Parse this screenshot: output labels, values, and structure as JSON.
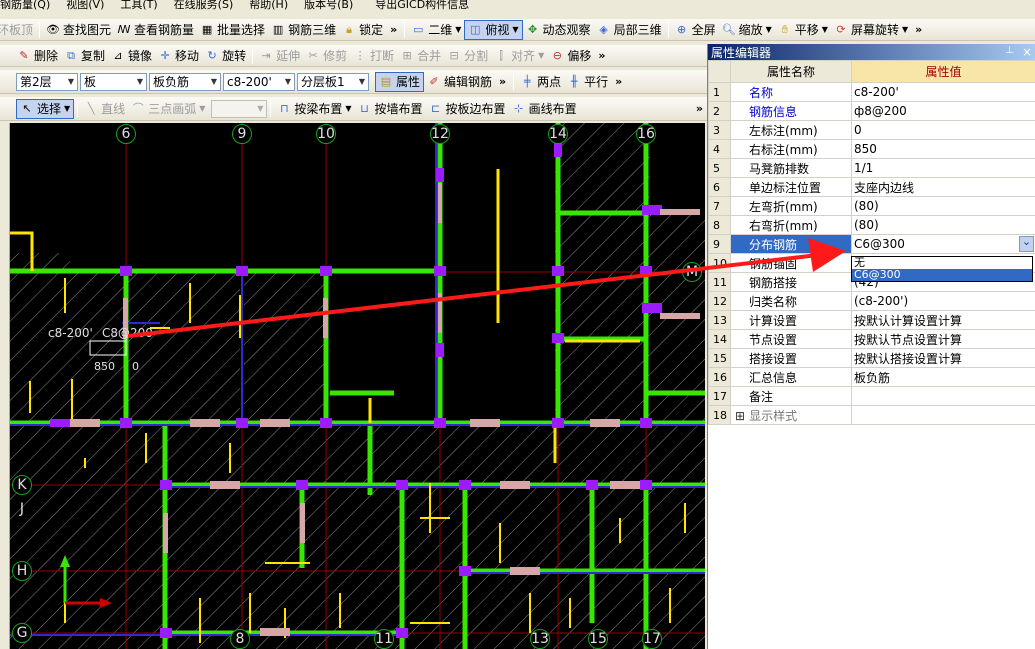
{
  "toolbar1": {
    "items": [
      "环板顶",
      "查找图元",
      "查看钢筋量",
      "批量选择",
      "钢筋三维",
      "锁定",
      "二维",
      "俯视",
      "动态观察",
      "局部三维",
      "全屏",
      "缩放",
      "平移",
      "屏幕旋转"
    ]
  },
  "menubar": {
    "items": [
      "钢筋量(Q)",
      "视图(V)",
      "工具(T)",
      "在线服务(S)",
      "帮助(H)",
      "版本号(B)",
      "导出GICD构件信息"
    ]
  },
  "toolbar2": {
    "items": [
      "删除",
      "复制",
      "镜像",
      "移动",
      "旋转",
      "延伸",
      "修剪",
      "打断",
      "合并",
      "分割",
      "对齐",
      "偏移"
    ]
  },
  "toolbar3": {
    "floor": "第2层",
    "type": "板",
    "subtype": "板负筋",
    "spec": "c8-200'",
    "layer": "分层板1",
    "prop_button": "属性",
    "edit_button": "编辑钢筋",
    "two_point": "两点",
    "parallel": "平行"
  },
  "toolbar4": {
    "select": "选择",
    "line": "直线",
    "arc": "三点画弧",
    "beam": "按梁布置",
    "wall": "按墙布置",
    "edge": "按板边布置",
    "drawline": "画线布置"
  },
  "panel": {
    "title": "属性编辑器",
    "pin": "ꟼ",
    "close": "×",
    "col_name": "属性名称",
    "col_value": "属性值",
    "rows": [
      {
        "n": "1",
        "name": "名称",
        "value": "c8-200'",
        "blue": true
      },
      {
        "n": "2",
        "name": "钢筋信息",
        "value": "ф8@200",
        "blue": true
      },
      {
        "n": "3",
        "name": "左标注(mm)",
        "value": "0"
      },
      {
        "n": "4",
        "name": "右标注(mm)",
        "value": "850"
      },
      {
        "n": "5",
        "name": "马凳筋排数",
        "value": "1/1"
      },
      {
        "n": "6",
        "name": "单边标注位置",
        "value": "支座内边线"
      },
      {
        "n": "7",
        "name": "左弯折(mm)",
        "value": "(80)"
      },
      {
        "n": "8",
        "name": "右弯折(mm)",
        "value": "(80)"
      },
      {
        "n": "9",
        "name": "分布钢筋",
        "value": "C6@300"
      },
      {
        "n": "10",
        "name": "钢筋锚固",
        "value": ""
      },
      {
        "n": "11",
        "name": "钢筋搭接",
        "value": "(42)"
      },
      {
        "n": "12",
        "name": "归类名称",
        "value": "(c8-200')"
      },
      {
        "n": "13",
        "name": "计算设置",
        "value": "按默认计算设置计算"
      },
      {
        "n": "14",
        "name": "节点设置",
        "value": "按默认节点设置计算"
      },
      {
        "n": "15",
        "name": "搭接设置",
        "value": "按默认搭接设置计算"
      },
      {
        "n": "16",
        "name": "汇总信息",
        "value": "板负筋"
      },
      {
        "n": "17",
        "name": "备注",
        "value": ""
      },
      {
        "n": "18",
        "name": "显示样式",
        "value": "",
        "expander": true
      }
    ],
    "dropdown_options": [
      "无",
      "C6@300"
    ]
  },
  "canvas": {
    "col_labels": [
      "6",
      "9",
      "10",
      "12",
      "14",
      "16"
    ],
    "row_labels": [
      "M",
      "K",
      "J",
      "H",
      "G"
    ],
    "bottom_labels": [
      "8",
      "11",
      "13",
      "15",
      "17"
    ],
    "annot_name": "c8-200'",
    "annot_dist": "C8@200",
    "annot_right": "850",
    "annot_left": "0",
    "axis_colors": {
      "grid": "#b00000",
      "wall": "#39e600",
      "beam": "#2b2bd0",
      "yellow": "#ffe400",
      "purple": "#9a1cff",
      "pink": "#d7a7a7"
    }
  }
}
